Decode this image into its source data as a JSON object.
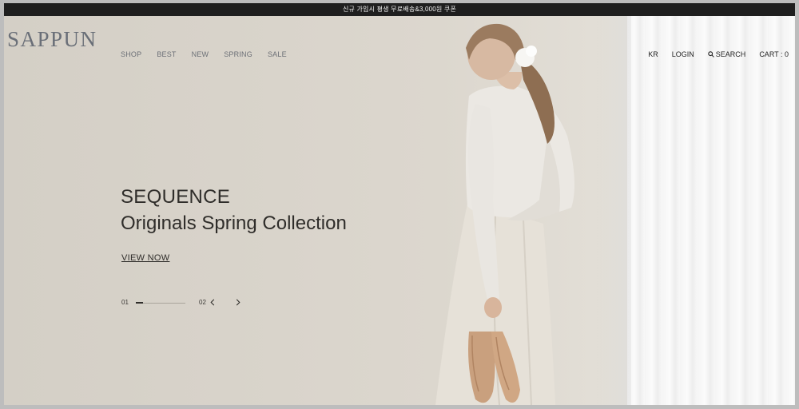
{
  "banner": {
    "text": "신규 가입시 평생 무료배송&3,000원 쿠폰"
  },
  "header": {
    "logo": "SAPPUN",
    "nav": [
      {
        "label": "SHOP"
      },
      {
        "label": "BEST"
      },
      {
        "label": "NEW"
      },
      {
        "label": "SPRING"
      },
      {
        "label": "SALE"
      }
    ],
    "util": {
      "lang": "KR",
      "login": "LOGIN",
      "search": "SEARCH",
      "cart": "CART : 0",
      "search_icon": "search-icon"
    }
  },
  "hero": {
    "title": "SEQUENCE",
    "subtitle": "Originals Spring Collection",
    "cta": "VIEW NOW",
    "slider": {
      "current": "01",
      "total": "02",
      "progress": 0.15,
      "prev_icon": "chevron-left-icon",
      "next_icon": "chevron-right-icon"
    }
  },
  "colors": {
    "banner_bg": "#1f1f1f",
    "hero_bg": "#d8d3ca",
    "text_dark": "#2f2d2a",
    "logo": "#6a6f78"
  }
}
